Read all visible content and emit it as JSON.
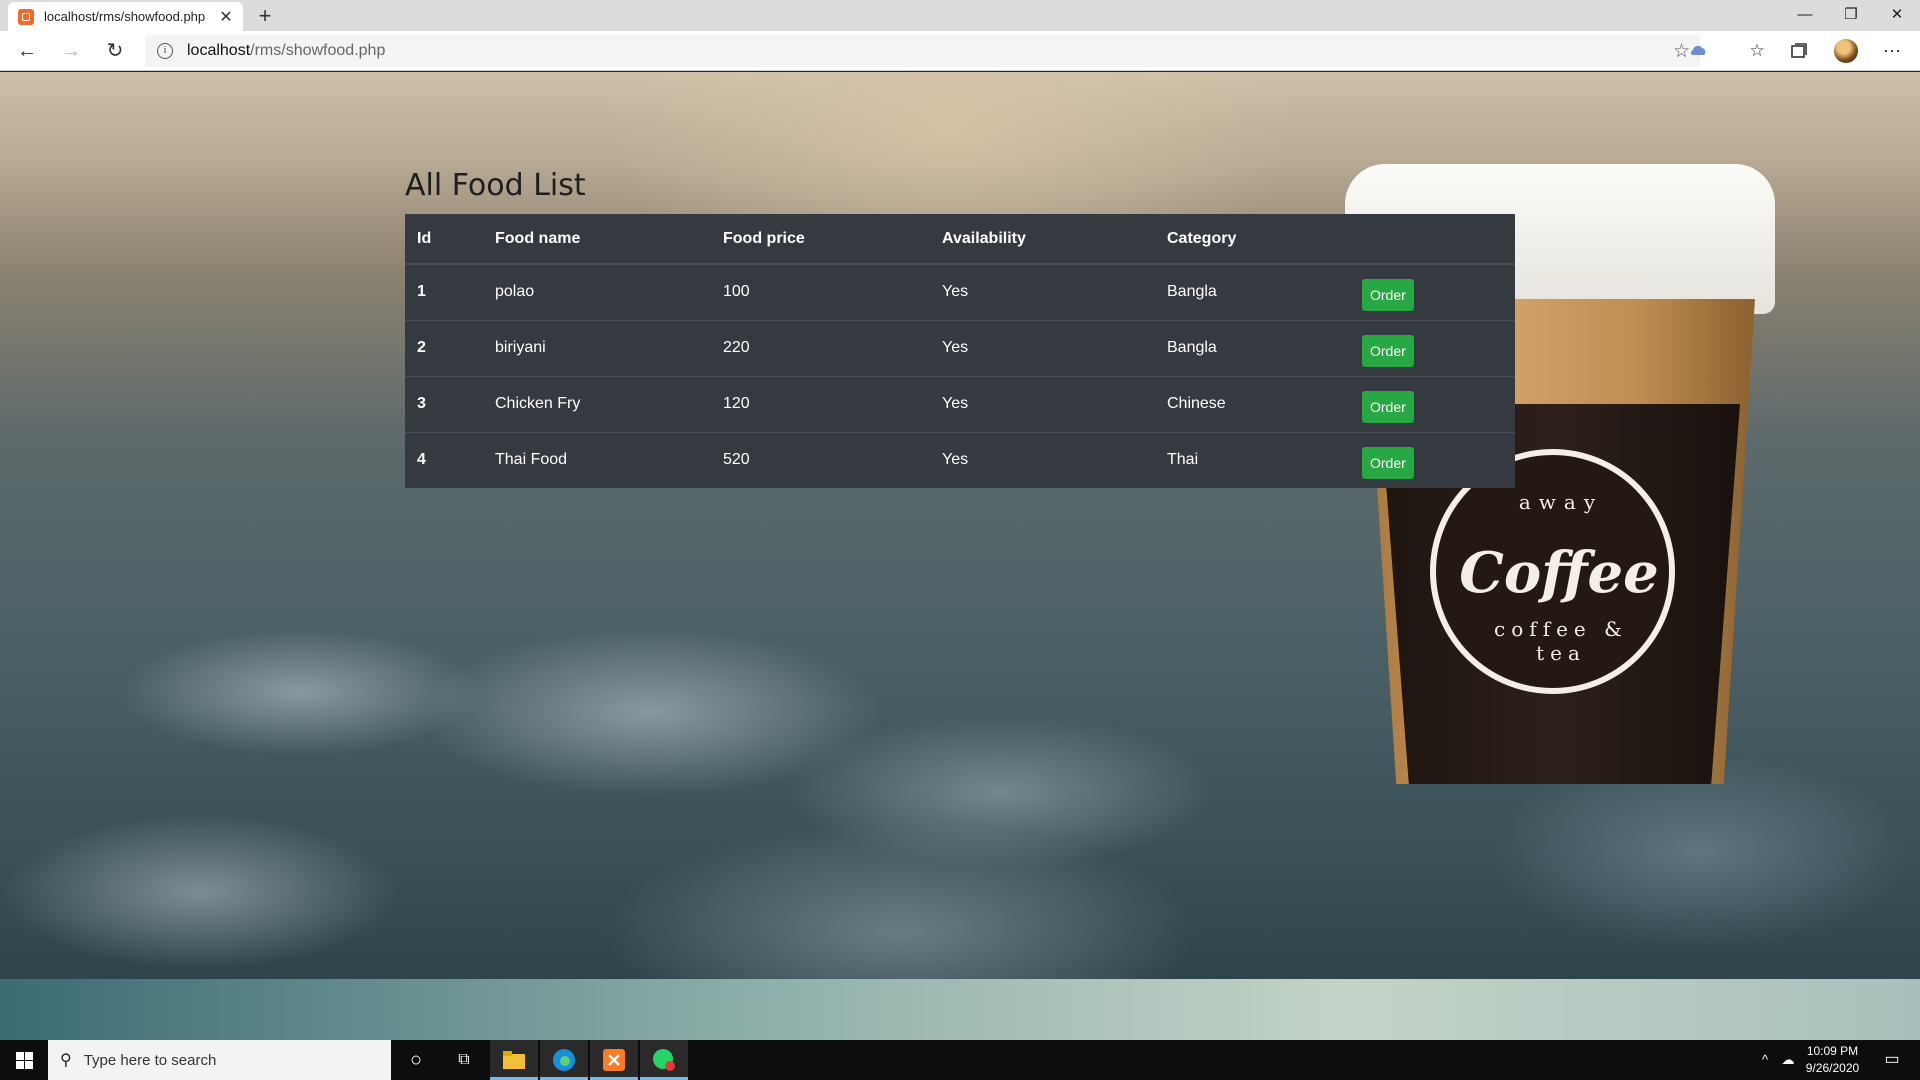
{
  "browser": {
    "tab_title": "localhost/rms/showfood.php",
    "tab_close": "✕",
    "new_tab": "+",
    "url_host": "localhost",
    "url_path": "/rms/showfood.php",
    "window_controls": [
      "—",
      "❐",
      "✕"
    ]
  },
  "page": {
    "title": "All Food List",
    "table": {
      "headers": [
        "Id",
        "Food name",
        "Food price",
        "Availability",
        "Category",
        ""
      ],
      "rows": [
        {
          "id": "1",
          "name": "polao",
          "price": "100",
          "availability": "Yes",
          "category": "Bangla",
          "action": "Order"
        },
        {
          "id": "2",
          "name": "biriyani",
          "price": "220",
          "availability": "Yes",
          "category": "Bangla",
          "action": "Order"
        },
        {
          "id": "3",
          "name": "Chicken Fry",
          "price": "120",
          "availability": "Yes",
          "category": "Chinese",
          "action": "Order"
        },
        {
          "id": "4",
          "name": "Thai Food",
          "price": "520",
          "availability": "Yes",
          "category": "Thai",
          "action": "Order"
        }
      ]
    },
    "background_art": {
      "cup_word": "Coffee",
      "cup_ring_bottom": "coffee & tea",
      "cup_ring_top": "away"
    }
  },
  "taskbar": {
    "search_placeholder": "Type here to search",
    "time": "10:09 PM",
    "date": "9/26/2020"
  },
  "colors": {
    "table_bg": "#343a40",
    "order_button": "#28a745",
    "taskbar": "#0d0d0d"
  }
}
